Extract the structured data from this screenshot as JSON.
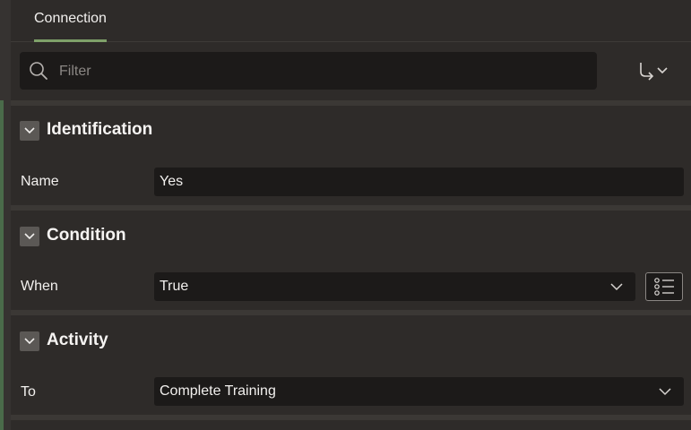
{
  "tabs": [
    {
      "label": "Connection",
      "active": true
    }
  ],
  "filter": {
    "placeholder": "Filter"
  },
  "sections": {
    "identification": {
      "title": "Identification",
      "name_label": "Name",
      "name_value": "Yes"
    },
    "condition": {
      "title": "Condition",
      "when_label": "When",
      "when_value": "True"
    },
    "activity": {
      "title": "Activity",
      "to_label": "To",
      "to_value": "Complete Training"
    }
  },
  "colors": {
    "accent": "#7fa16a",
    "background": "#2e2b29",
    "field": "#1c1a19"
  }
}
